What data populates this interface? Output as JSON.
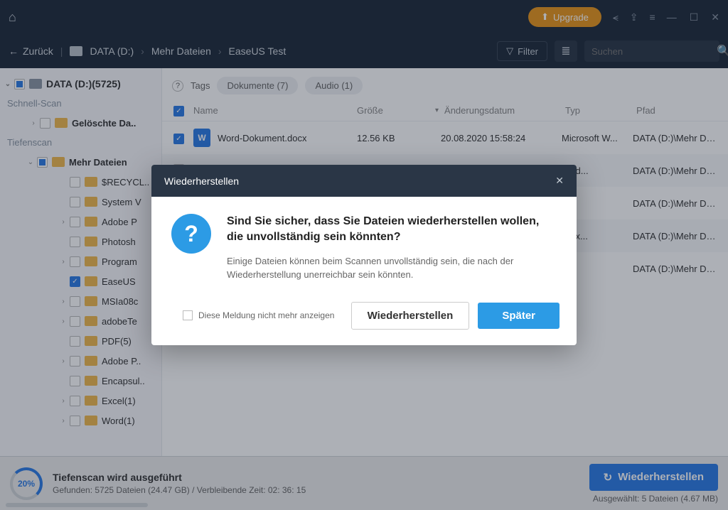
{
  "titlebar": {
    "upgrade": "Upgrade"
  },
  "nav": {
    "back": "Zurück",
    "crumbs": [
      "DATA (D:)",
      "Mehr Dateien",
      "EaseUS Test"
    ],
    "filter": "Filter",
    "search_placeholder": "Suchen"
  },
  "sidebar": {
    "root": "DATA (D:)(5725)",
    "quick_label": "Schnell-Scan",
    "quick_items": [
      {
        "label": "Gelöschte Da..",
        "chk": "empty",
        "bold": true
      }
    ],
    "deep_label": "Tiefenscan",
    "deep_root": {
      "label": "Mehr Dateien",
      "chk": "partial",
      "bold": true
    },
    "deep_items": [
      {
        "label": "$RECYCL..",
        "chk": "empty",
        "exp": false
      },
      {
        "label": "System V",
        "chk": "empty",
        "exp": false
      },
      {
        "label": "Adobe P",
        "chk": "empty",
        "exp": true
      },
      {
        "label": "Photosh",
        "chk": "empty",
        "exp": false
      },
      {
        "label": "Program",
        "chk": "empty",
        "exp": true
      },
      {
        "label": "EaseUS ",
        "chk": "checked",
        "exp": false
      },
      {
        "label": "MSIa08c",
        "chk": "empty",
        "exp": true
      },
      {
        "label": "adobeTe",
        "chk": "empty",
        "exp": true
      },
      {
        "label": "PDF(5)",
        "chk": "empty",
        "exp": false
      },
      {
        "label": "Adobe P..",
        "chk": "empty",
        "exp": true
      },
      {
        "label": "Encapsul..",
        "chk": "empty",
        "exp": false
      },
      {
        "label": "Excel(1)",
        "chk": "empty",
        "exp": true
      },
      {
        "label": "Word(1)",
        "chk": "empty",
        "exp": true
      }
    ]
  },
  "tags": {
    "label": "Tags",
    "chips": [
      "Dokumente (7)",
      "Audio (1)"
    ]
  },
  "cols": {
    "name": "Name",
    "size": "Größe",
    "date": "Änderungsdatum",
    "type": "Typ",
    "path": "Pfad"
  },
  "rows": [
    {
      "name": "Word-Dokument.docx",
      "icon": "W",
      "size": "12.56 KB",
      "date": "20.08.2020 15:58:24",
      "type": "Microsoft W...",
      "path": "DATA (D:)\\Mehr Date...",
      "chk": "checked"
    },
    {
      "name": "",
      "icon": "",
      "size": "",
      "date": "",
      "type": "...Ed...",
      "path": "DATA (D:)\\Mehr Date...",
      "chk": ""
    },
    {
      "name": "",
      "icon": "",
      "size": "",
      "date": "",
      "type": "...ei",
      "path": "DATA (D:)\\Mehr Date...",
      "chk": ""
    },
    {
      "name": "",
      "icon": "",
      "size": "",
      "date": "",
      "type": "...Ex...",
      "path": "DATA (D:)\\Mehr Date...",
      "chk": ""
    },
    {
      "name": "",
      "icon": "",
      "size": "",
      "date": "",
      "type": "",
      "path": "DATA (D:)\\Mehr Date...",
      "chk": ""
    }
  ],
  "status": {
    "percent": "20%",
    "title": "Tiefenscan wird ausgeführt",
    "sub": "Gefunden: 5725 Dateien (24.47 GB) / Verbleibende Zeit: 02: 36: 15",
    "recover": "Wiederherstellen",
    "selected": "Ausgewählt: 5 Dateien (4.67 MB)"
  },
  "modal": {
    "title": "Wiederherstellen",
    "heading": "Sind Sie sicher, dass Sie Dateien wiederherstellen wollen, die unvollständig sein könnten?",
    "body": "Einige Dateien können beim Scannen unvollständig sein, die nach der Wiederherstellung unerreichbar sein könnten.",
    "dont_show": "Diese Meldung nicht mehr anzeigen",
    "confirm": "Wiederherstellen",
    "later": "Später"
  }
}
